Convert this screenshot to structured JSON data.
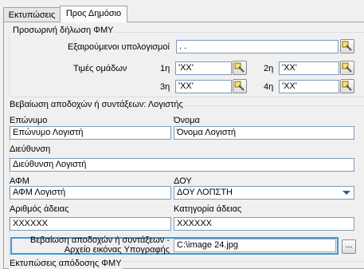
{
  "tabs": [
    {
      "label": "Εκτυπώσεις"
    },
    {
      "label": "Προς Δημόσιο"
    }
  ],
  "fmy": {
    "title": "Προσωρινή δήλωση ΦΜΥ",
    "exempt_label": "Εξαιρούμενοι υπολογισμοί",
    "exempt_value": ".     .",
    "groups_label": "Τιμές ομάδων",
    "g1_label": "1η",
    "g1_value": "'XX'",
    "g2_label": "2η",
    "g2_value": "'XX'",
    "g3_label": "3η",
    "g3_value": "'XX'",
    "g4_label": "4η",
    "g4_value": "'XX'"
  },
  "accountant": {
    "title": "Βεβαίωση αποδοχών ή συντάξεων: Λογιστής",
    "surname_label": "Επώνυμο",
    "surname_value": "Επώνυμο Λογιστή",
    "name_label": "Όνομα",
    "name_value": "Όνομα Λογιστή",
    "address_label": "Διεύθυνση",
    "address_value": "Διεύθυνση Λογιστή",
    "afm_label": "ΑΦΜ",
    "afm_value": "ΑΦΜ Λογιστή",
    "doy_label": "ΔΟΥ",
    "doy_value": "ΔΟΥ ΛΟΠΣΤΗ",
    "license_no_label": "Αριθμός άδειας",
    "license_no_value": "XXXXXX",
    "license_cat_label": "Κατηγορία άδειας",
    "license_cat_value": "XXXXXX",
    "signature_label_1": "Βεβαίωση αποδοχών ή συντάξεων -",
    "signature_label_2": "Αρχείο εικόνας Υπογραφής",
    "signature_value": "C:\\image 24.jpg",
    "browse_label": "..."
  },
  "next_section_title": "Εκτυπώσεις απόδοσης ΦΜΥ"
}
